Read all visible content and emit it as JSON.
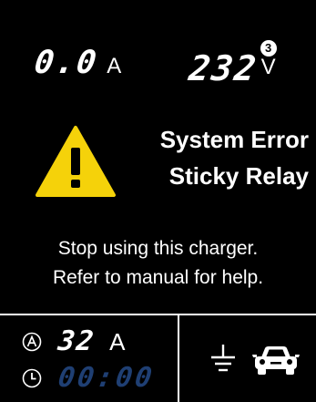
{
  "readouts": {
    "current": {
      "value": "0.0",
      "unit": "A"
    },
    "voltage": {
      "value": "232",
      "unit": "V",
      "phase": "3"
    }
  },
  "alert": {
    "line1": "System Error",
    "line2": "Sticky Relay",
    "message_line1": "Stop using this charger.",
    "message_line2": "Refer to manual for help."
  },
  "status_bar": {
    "current_limit": {
      "value": "32",
      "unit": "A"
    },
    "timer": {
      "value": "00:00"
    }
  },
  "icons": {
    "warning": "warning-triangle-icon",
    "current_limit": "circled-a-icon",
    "timer": "clock-icon",
    "ground": "ground-icon",
    "vehicle": "car-icon"
  },
  "colors": {
    "background": "#000000",
    "text": "#ffffff",
    "warning_fill": "#f5d20a",
    "timer_inactive": "#1f3f73"
  }
}
